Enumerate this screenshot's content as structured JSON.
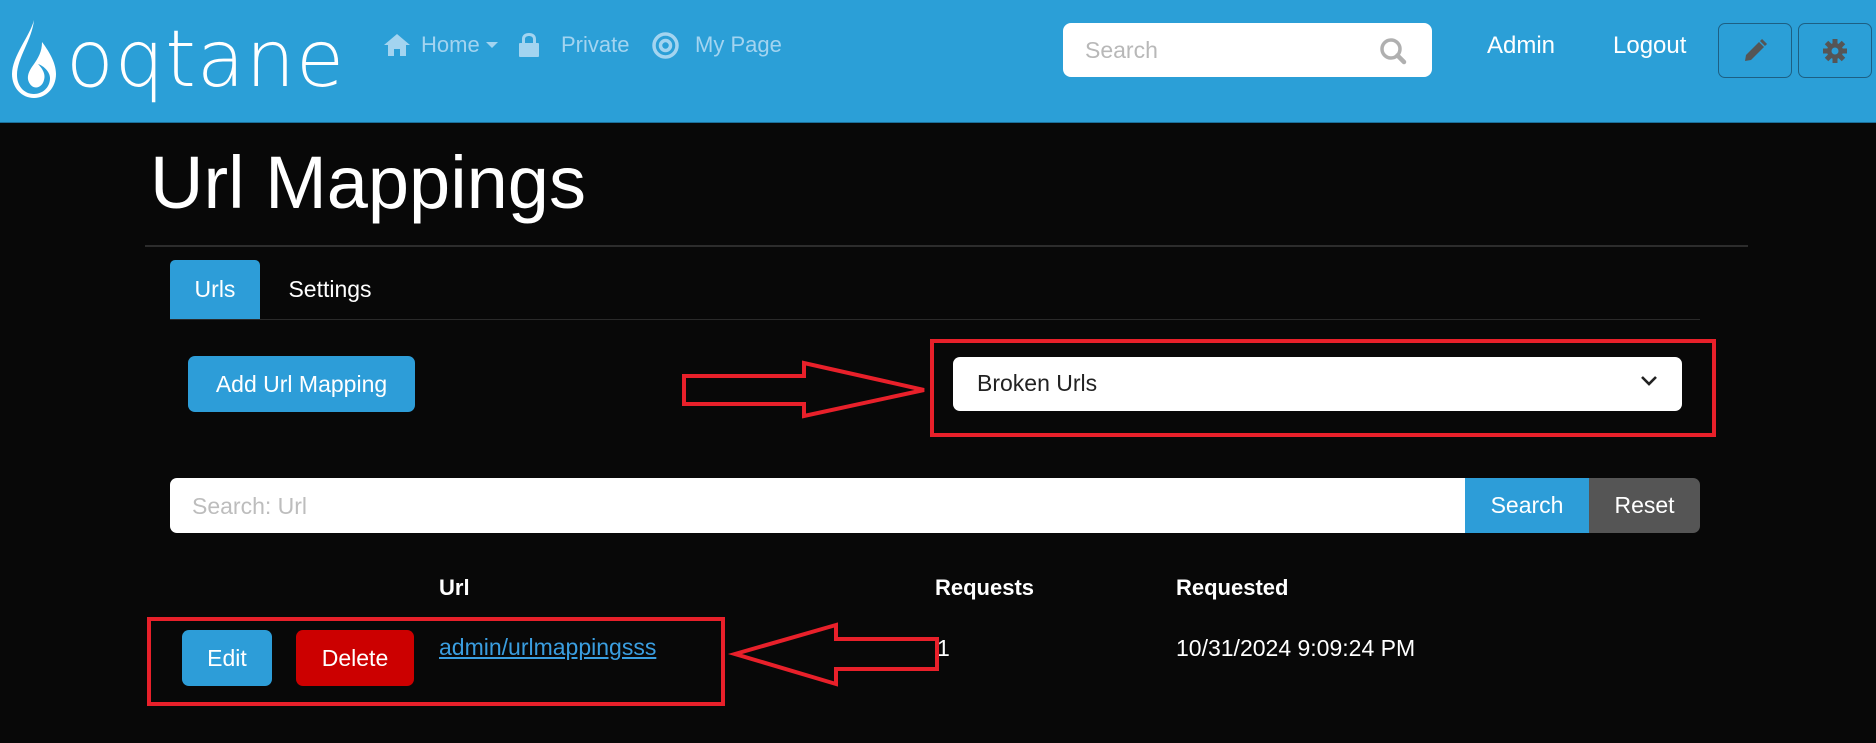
{
  "header": {
    "logo_text": "oqtane",
    "nav": [
      {
        "label": "Home",
        "icon": "home-icon",
        "has_dropdown": true
      },
      {
        "label": "Private",
        "icon": "lock-icon"
      },
      {
        "label": "My Page",
        "icon": "target-icon"
      }
    ],
    "search_placeholder": "Search",
    "admin_label": "Admin",
    "logout_label": "Logout",
    "edit_icon": "pencil-icon",
    "settings_icon": "gear-icon",
    "colors": {
      "bar": "#2b9fd7",
      "nav_text": "#a3d4f0"
    }
  },
  "page": {
    "title": "Url Mappings",
    "tabs": [
      {
        "label": "Urls",
        "active": true
      },
      {
        "label": "Settings",
        "active": false
      }
    ],
    "add_button": "Add Url Mapping",
    "filter_select": {
      "selected": "Broken Urls"
    },
    "search": {
      "placeholder": "Search: Url",
      "value": "",
      "search_button": "Search",
      "reset_button": "Reset"
    },
    "table": {
      "columns": [
        "",
        "Url",
        "Requests",
        "Requested"
      ],
      "rows": [
        {
          "edit_label": "Edit",
          "delete_label": "Delete",
          "url": "admin/urlmappingsss",
          "requests": "1",
          "requested": "10/31/2024 9:09:24 PM"
        }
      ]
    }
  },
  "annotations": {
    "color": "#e8202a",
    "items": [
      "arrow-right pointing to filter select",
      "box around filter select",
      "arrow-left pointing to table row",
      "box around row actions and url"
    ]
  },
  "colors": {
    "primary": "#2d9dd8",
    "danger": "#cc0000",
    "secondary": "#555555",
    "background": "#080808",
    "link": "#3a9ee0"
  }
}
